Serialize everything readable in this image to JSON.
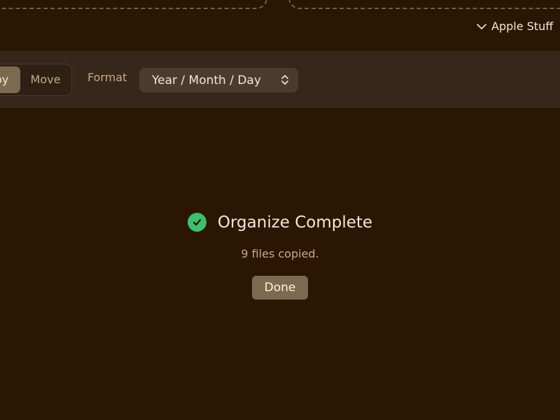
{
  "destination": {
    "label": "Apple Stuff",
    "icon": "chevron-down-icon"
  },
  "mode": {
    "options": [
      "Copy",
      "Move"
    ],
    "selected": "Copy",
    "copy_visible_label": "py",
    "move_label": "Move"
  },
  "format": {
    "label": "Format",
    "value": "Year / Month / Day",
    "icon": "updown-chevron-icon"
  },
  "result": {
    "title": "Organize Complete",
    "message": "9 files copied.",
    "done_label": "Done",
    "icon": "check-circle-icon",
    "colors": {
      "success": "#3fbf6b",
      "background": "#2b1604",
      "toolbar": "#37261a",
      "accent": "#7b6a50"
    }
  }
}
